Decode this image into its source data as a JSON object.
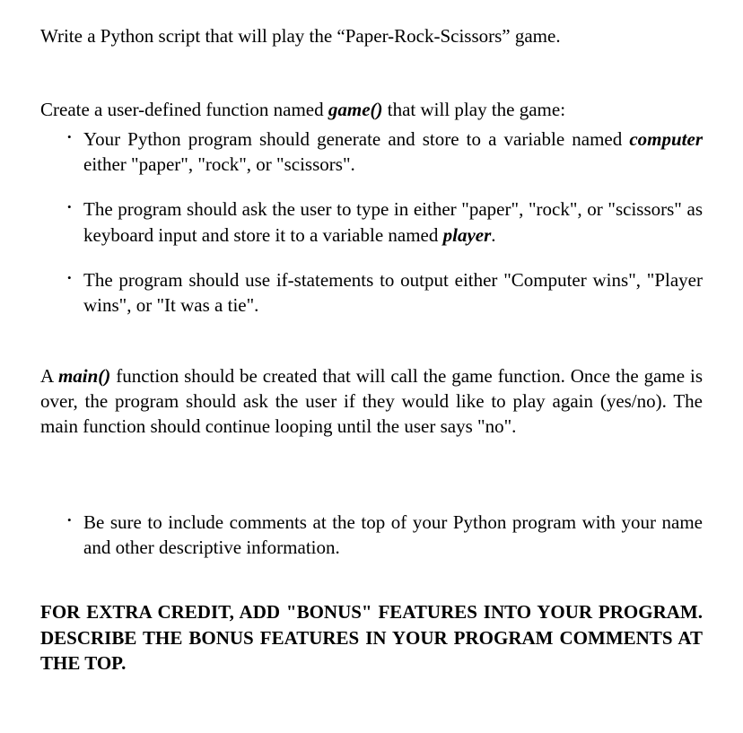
{
  "heading": "Write a Python script that will play the “Paper-Rock-Scissors” game.",
  "intro": {
    "prefix": "Create a user-defined function named ",
    "fn": "game()",
    "suffix": " that will play the game:"
  },
  "bullets1": {
    "b1": {
      "prefix": "Your Python program should generate and store to a variable named ",
      "var": "computer",
      "suffix": " either \"paper\", \"rock\", or \"scissors\"."
    },
    "b2": {
      "prefix": "The program should ask the user to type in either \"paper\", \"rock\", or \"scissors\" as keyboard input and store it to a variable named ",
      "var": "player",
      "suffix": "."
    },
    "b3": "The program should use if-statements to output either \"Computer wins\", \"Player wins\", or \"It was a tie\"."
  },
  "main_para": {
    "prefix": "A ",
    "fn": "main()",
    "suffix": " function should be created that will call the game function. Once the game is over, the program should ask the user if they would like to play again (yes/no). The main function should continue looping until the user says \"no\"."
  },
  "bullets2": {
    "b1": "Be sure to include comments at the top of your Python program with your name and other descriptive information."
  },
  "extra_credit": "FOR EXTRA CREDIT, ADD \"BONUS\" FEATURES INTO YOUR PROGRAM. DESCRIBE THE BONUS FEATURES IN YOUR PROGRAM COMMENTS AT THE TOP.",
  "dot": "•"
}
